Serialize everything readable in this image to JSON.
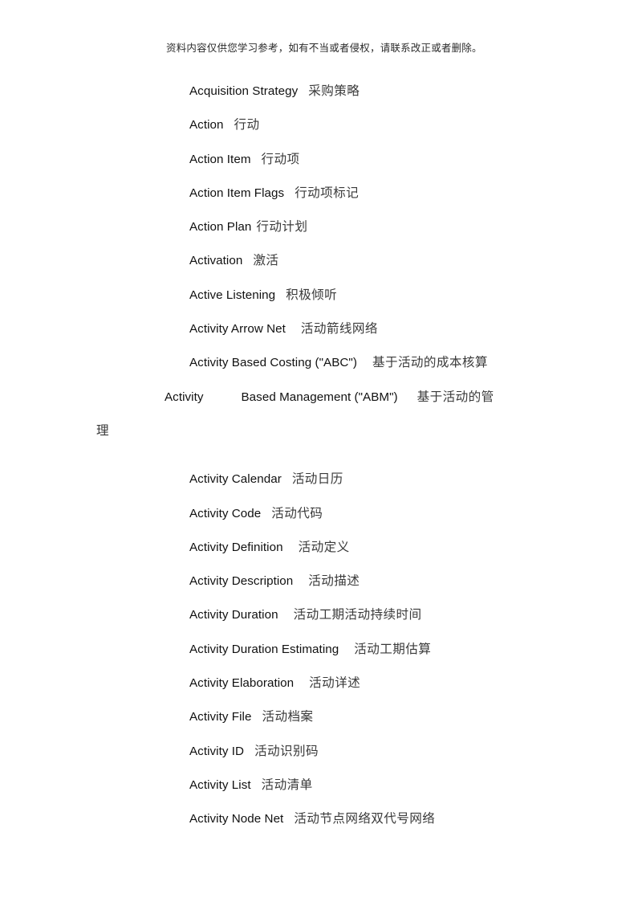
{
  "document": {
    "header_notice": "资料内容仅供您学习参考，如有不当或者侵权，请联系改正或者删除。",
    "page_background": "#ffffff",
    "term_color": "#111111",
    "translation_color": "#3a3a3a"
  },
  "glossary": {
    "entries": [
      {
        "term": "Acquisition Strategy",
        "translation": "采购策略",
        "gap": "2"
      },
      {
        "term": "Action",
        "translation": "行动",
        "gap": "2"
      },
      {
        "term": "Action Item",
        "translation": "行动项",
        "gap": "2"
      },
      {
        "term": "Action Item Flags",
        "translation": "行动项标记",
        "gap": "2"
      },
      {
        "term": "Action Plan",
        "translation": "行动计划",
        "gap": "1"
      },
      {
        "term": "Activation",
        "translation": "激活",
        "gap": "2"
      },
      {
        "term": "Active Listening",
        "translation": "积极倾听",
        "gap": "2"
      },
      {
        "term": "Activity Arrow Net",
        "translation": "活动箭线网络",
        "gap": "3"
      },
      {
        "term": "Activity Based Costing (\"ABC\")",
        "translation": "基于活动的成本核算",
        "gap": "3"
      },
      {
        "term": "Activity Calendar",
        "translation": "活动日历",
        "gap": "2"
      },
      {
        "term": "Activity Code",
        "translation": "活动代码",
        "gap": "2"
      },
      {
        "term": "Activity Definition",
        "translation": "活动定义",
        "gap": "3"
      },
      {
        "term": "Activity Description",
        "translation": "活动描述",
        "gap": "3"
      },
      {
        "term": "Activity Duration",
        "translation": "活动工期活动持续时间",
        "gap": "3"
      },
      {
        "term": "Activity Duration Estimating",
        "translation": "活动工期估算",
        "gap": "3"
      },
      {
        "term": "Activity Elaboration",
        "translation": "活动详述",
        "gap": "3"
      },
      {
        "term": "Activity File",
        "translation": "活动档案",
        "gap": "2"
      },
      {
        "term": "Activity ID",
        "translation": "活动识别码",
        "gap": "2"
      },
      {
        "term": "Activity List",
        "translation": "活动清单",
        "gap": "2"
      },
      {
        "term": "Activity Node Net",
        "translation": "活动节点网络双代号网络",
        "gap": "2"
      }
    ],
    "wrapped_entry": {
      "term_part1": "Activity",
      "term_part2": "Based Management (\"ABM\")",
      "translation_part1": "基于活动的管",
      "translation_part2": "理"
    }
  }
}
